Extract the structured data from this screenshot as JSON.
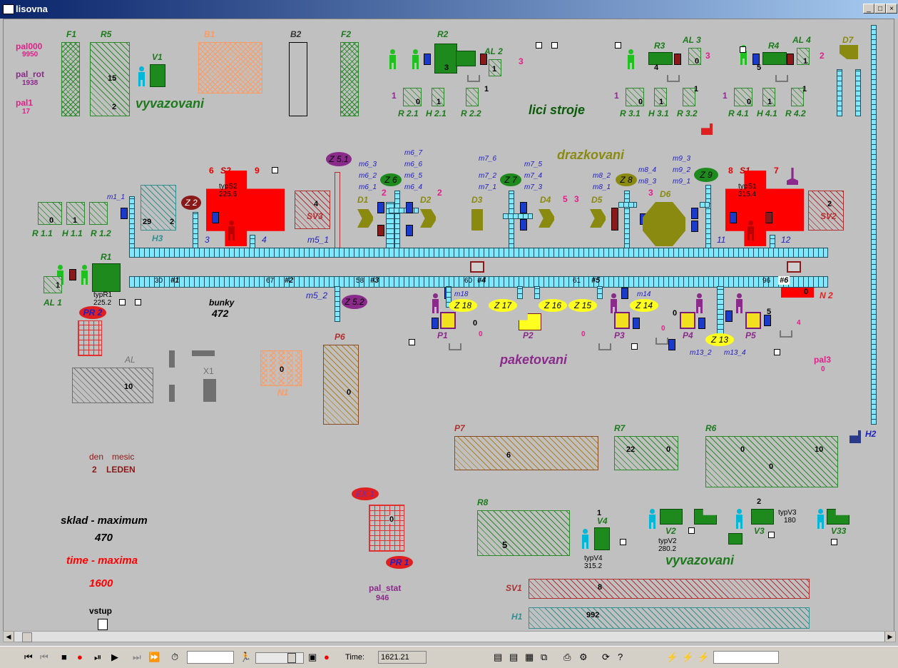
{
  "window": {
    "title": "lisovna",
    "buttons": [
      "_",
      "□",
      "×"
    ]
  },
  "left_stats": [
    {
      "label": "pal000",
      "value": "9950"
    },
    {
      "label": "pal_rot",
      "value": "1938"
    },
    {
      "label": "pal1",
      "value": "17"
    }
  ],
  "labels": {
    "F1": "F1",
    "R5": "R5",
    "B1": "B1",
    "B2": "B2",
    "F2": "F2",
    "V1": "V1",
    "vyvazovani_top": "vyvazovani",
    "R2": "R2",
    "AL2": "AL 2",
    "R3": "R3",
    "AL3": "AL 3",
    "R4": "R4",
    "AL4": "AL 4",
    "D7": "D7",
    "lici_stroje": "lici stroje",
    "drazkovani": "drazkovani",
    "R21": "R 2.1",
    "H21": "H 2.1",
    "R22": "R 2.2",
    "R31": "R 3.1",
    "H31": "H 3.1",
    "R32": "R 3.2",
    "R41": "R 4.1",
    "H41": "H 4.1",
    "R42": "R 4.2",
    "R11": "R 1.1",
    "H11": "H 1.1",
    "R12": "R 1.2",
    "H3": "H3",
    "Z2": "Z 2",
    "S2": "S2",
    "typS2": "typS2",
    "typS2v": "225.6",
    "SV3": "SV3",
    "Z51": "Z 5.1",
    "Z6": "Z 6",
    "Z7": "Z 7",
    "Z8": "Z 8",
    "Z9": "Z 9",
    "S1": "S1",
    "typS1": "typS1",
    "typS1v": "315.4",
    "SV2": "SV2",
    "D1": "D1",
    "D2": "D2",
    "D3": "D3",
    "D4": "D4",
    "D5": "D5",
    "D6": "D6",
    "m1_1": "m1_1",
    "m5_1": "m5_1",
    "m5_2": "m5_2",
    "m6_3": "m6_3",
    "m6_2": "m6_2",
    "m6_1": "m6_1",
    "m6_7": "m6_7",
    "m6_6": "m6_6",
    "m6_5": "m6_5",
    "m6_4": "m6_4",
    "m7_6": "m7_6",
    "m7_2": "m7_2",
    "m7_1": "m7_1",
    "m7_5": "m7_5",
    "m7_4": "m7_4",
    "m7_3": "m7_3",
    "m8_2": "m8_2",
    "m8_1": "m8_1",
    "m8_4": "m8_4",
    "m8_3": "m8_3",
    "m9_3": "m9_3",
    "m9_2": "m9_2",
    "m9_1": "m9_1",
    "R1": "R1",
    "AL1": "AL 1",
    "typR1": "typR1",
    "typR1v": "225.2",
    "PR2": "PR 2",
    "bunky": "bunky",
    "bunkyv": "472",
    "Z52": "Z 5.2",
    "m18": "m18",
    "Z18": "Z 18",
    "Z17": "Z 17",
    "Z16": "Z 16",
    "Z15": "Z 15",
    "m14": "m14",
    "Z14": "Z 14",
    "Z13": "Z 13",
    "P1": "P1",
    "P2": "P2",
    "P3": "P3",
    "P4": "P4",
    "P5": "P5",
    "P6": "P6",
    "P7": "P7",
    "N2": "N 2",
    "N1": "N1",
    "m13_2": "m13_2",
    "m13_4": "m13_4",
    "paketovani": "paketovani",
    "pal3": "pal3",
    "pal3v": "0",
    "AL": "AL",
    "X1": "X1",
    "R7": "R7",
    "R6": "R6",
    "H2": "H2",
    "R8": "R8",
    "EX1": "EX 1",
    "PR1": "PR 1",
    "V4": "V4",
    "V2": "V2",
    "V3": "V3",
    "V33": "V33",
    "typV2": "typV2",
    "typV2v": "280.2",
    "typV3": "typV3",
    "typV3v": "180",
    "typV4": "typV4",
    "typV4v": "315.2",
    "vyvazovani_bot": "vyvazovani",
    "SV1": "SV1",
    "H1": "H1",
    "pal_stat": "pal_stat",
    "pal_statv": "946",
    "den": "den",
    "mesic": "mesic",
    "den_v": "2",
    "mesic_v": "LEDEN",
    "sklad": "sklad - maximum",
    "skladv": "470",
    "time": "time - maxima",
    "timev": "1600",
    "vstup": "vstup"
  },
  "values": {
    "R5": "15",
    "R5b": "2",
    "R21": "0",
    "H21": "1",
    "R31": "0",
    "H31": "1",
    "R41": "0",
    "H41": "1",
    "R11": "0",
    "H11": "1",
    "H3a": "29",
    "H3b": "2",
    "SV3": "4",
    "SV2": "2",
    "AL1": "1",
    "AL3": "0",
    "AL4": "1",
    "AL2": "1",
    "R2n": "3",
    "R3n": "4",
    "R4n": "5",
    "r22": "1",
    "r32": "1",
    "r42": "1",
    "one21": "1",
    "one31": "1",
    "one41": "1",
    "al2r": "3",
    "al3r": "3",
    "al4r": "2",
    "S2l": "6",
    "S2r": "9",
    "S1l": "8",
    "S1r": "7",
    "S2a": "3",
    "S2b": "4",
    "S1a": "11",
    "S1b": "12",
    "d1": "2",
    "d2": "2",
    "d45a": "5",
    "d45b": "3",
    "d6": "3",
    "c30": "30",
    "c67": "67",
    "c58": "58",
    "c60": "60",
    "c61": "61",
    "c96": "96",
    "n1": "#1",
    "n2": "#2",
    "n3": "#3",
    "n4": "#4",
    "n5": "#5",
    "n6": "#6",
    "N2": "0",
    "P1a": "0",
    "P1b": "0",
    "P2": "0",
    "P3": "0",
    "P4a": "0",
    "P5a": "5",
    "P5b": "4",
    "AL": "10",
    "N1": "0",
    "P6": "0",
    "P7": "6",
    "R7a": "22",
    "R7b": "0",
    "R6a": "0",
    "R6b": "10",
    "R6c": "0",
    "R8": "5",
    "EX": "0",
    "SV1": "8",
    "H1": "992",
    "V4": "1",
    "V3": "2"
  },
  "statusbar": {
    "time_label": "Time:",
    "time_value": "1621.21",
    "input1": "",
    "input2": ""
  },
  "colors": {
    "red": "#ff0000",
    "green": "#1e8a1e",
    "cyan": "#7fe8ff",
    "olive": "#8a8a10",
    "violet": "#8a2a8a",
    "yellow": "#ffff20",
    "pink": "#e0208a"
  }
}
